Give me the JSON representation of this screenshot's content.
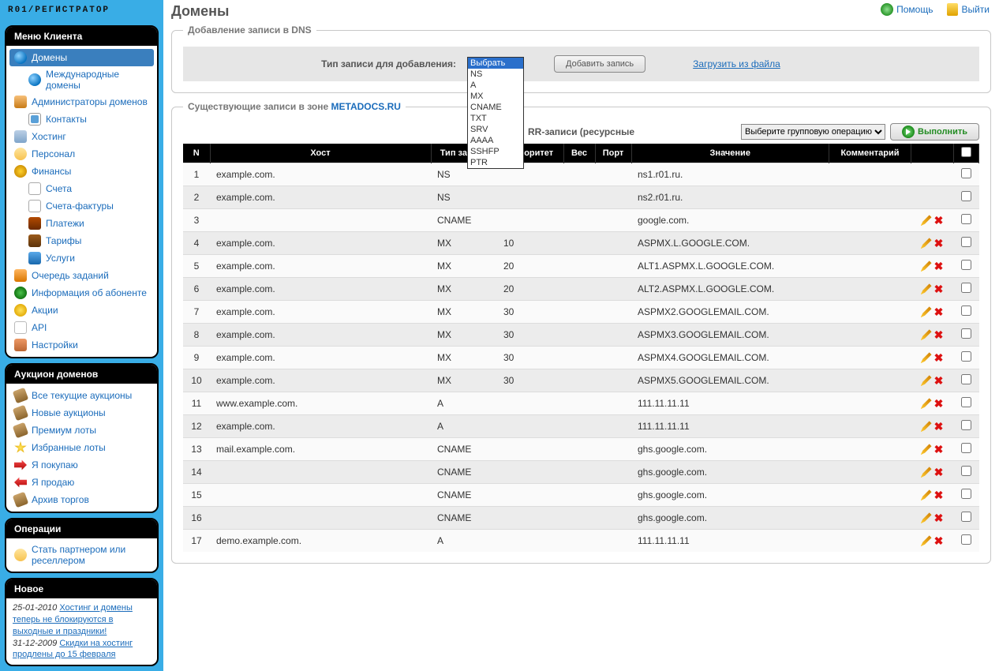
{
  "logo": "R01/РЕГИСТРАТОР",
  "head": {
    "title": "Домены",
    "help": "Помощь",
    "exit": "Выйти"
  },
  "sidebar": {
    "client_menu_hd": "Меню Клиента",
    "items": [
      {
        "label": "Домены",
        "icon": "globe",
        "sel": true
      },
      {
        "label": "Международные домены",
        "icon": "globe",
        "sub": true
      },
      {
        "label": "Администраторы доменов",
        "icon": "users"
      },
      {
        "label": "Контакты",
        "icon": "contact",
        "sub": true
      },
      {
        "label": "Хостинг",
        "icon": "host"
      },
      {
        "label": "Персонал",
        "icon": "person"
      },
      {
        "label": "Финансы",
        "icon": "money"
      },
      {
        "label": "Счета",
        "icon": "doc",
        "sub": true
      },
      {
        "label": "Счета-фактуры",
        "icon": "doc",
        "sub": true
      },
      {
        "label": "Платежи",
        "icon": "pay",
        "sub": true
      },
      {
        "label": "Тарифы",
        "icon": "tarif",
        "sub": true
      },
      {
        "label": "Услуги",
        "icon": "serv",
        "sub": true
      },
      {
        "label": "Очередь заданий",
        "icon": "queue"
      },
      {
        "label": "Информация об абоненте",
        "icon": "info"
      },
      {
        "label": "Акции",
        "icon": "star"
      },
      {
        "label": "API",
        "icon": "api"
      },
      {
        "label": "Настройки",
        "icon": "set"
      }
    ],
    "auction_hd": "Аукцион доменов",
    "auction": [
      {
        "label": "Все текущие аукционы",
        "icon": "hammer"
      },
      {
        "label": "Новые аукционы",
        "icon": "hammer"
      },
      {
        "label": "Премиум лоты",
        "icon": "hammer"
      },
      {
        "label": "Избранные лоты",
        "icon": "starS"
      },
      {
        "label": "Я покупаю",
        "icon": "arrowr"
      },
      {
        "label": "Я продаю",
        "icon": "arrowl"
      },
      {
        "label": "Архив торгов",
        "icon": "hammer"
      }
    ],
    "ops_hd": "Операции",
    "ops": [
      {
        "label": "Стать партнером или реселлером",
        "icon": "person"
      }
    ],
    "news_hd": "Новое",
    "news": [
      {
        "date": "25-01-2010",
        "text": "Хостинг и домены теперь не блокируются в выходные и праздники!"
      },
      {
        "date": "31-12-2009",
        "text": "Скидки на хостинг продлены до 15 февраля"
      }
    ]
  },
  "add": {
    "legend": "Добавление записи в DNS",
    "label": "Тип записи для добавления:",
    "select_value": "Выбрать",
    "options": [
      "Выбрать",
      "NS",
      "A",
      "MX",
      "CNAME",
      "TXT",
      "SRV",
      "AAAA",
      "SSHFP",
      "PTR"
    ],
    "btn_add": "Добавить запись",
    "upload_link": "Загрузить из файла"
  },
  "zone": {
    "legend_prefix": "Существующие записи в зоне",
    "zone_name": "METADOCS.RU",
    "rr_title": "RR-записи (ресурсные",
    "group_op_placeholder": "Выберите групповую операцию",
    "run_btn": "Выполнить",
    "cols": {
      "n": "N",
      "host": "Хост",
      "type": "Тип записи",
      "pri": "Приоритет",
      "wt": "Вес",
      "port": "Порт",
      "val": "Значение",
      "comm": "Комментарий"
    },
    "rows": [
      {
        "n": 1,
        "host": "example.com.",
        "type": "NS",
        "pri": "",
        "val": "ns1.r01.ru.",
        "editable": false
      },
      {
        "n": 2,
        "host": "example.com.",
        "type": "NS",
        "pri": "",
        "val": "ns2.r01.ru.",
        "editable": false
      },
      {
        "n": 3,
        "host": "",
        "type": "CNAME",
        "pri": "",
        "val": "google.com.",
        "editable": true
      },
      {
        "n": 4,
        "host": "example.com.",
        "type": "MX",
        "pri": "10",
        "val": "ASPMX.L.GOOGLE.COM.",
        "editable": true
      },
      {
        "n": 5,
        "host": "example.com.",
        "type": "MX",
        "pri": "20",
        "val": "ALT1.ASPMX.L.GOOGLE.COM.",
        "editable": true
      },
      {
        "n": 6,
        "host": "example.com.",
        "type": "MX",
        "pri": "20",
        "val": "ALT2.ASPMX.L.GOOGLE.COM.",
        "editable": true
      },
      {
        "n": 7,
        "host": "example.com.",
        "type": "MX",
        "pri": "30",
        "val": "ASPMX2.GOOGLEMAIL.COM.",
        "editable": true
      },
      {
        "n": 8,
        "host": "example.com.",
        "type": "MX",
        "pri": "30",
        "val": "ASPMX3.GOOGLEMAIL.COM.",
        "editable": true
      },
      {
        "n": 9,
        "host": "example.com.",
        "type": "MX",
        "pri": "30",
        "val": "ASPMX4.GOOGLEMAIL.COM.",
        "editable": true
      },
      {
        "n": 10,
        "host": "example.com.",
        "type": "MX",
        "pri": "30",
        "val": "ASPMX5.GOOGLEMAIL.COM.",
        "editable": true
      },
      {
        "n": 11,
        "host": "www.example.com.",
        "type": "A",
        "pri": "",
        "val": "111.11.11.11",
        "editable": true
      },
      {
        "n": 12,
        "host": "example.com.",
        "type": "A",
        "pri": "",
        "val": "111.11.11.11",
        "editable": true
      },
      {
        "n": 13,
        "host": "mail.example.com.",
        "type": "CNAME",
        "pri": "",
        "val": "ghs.google.com.",
        "editable": true
      },
      {
        "n": 14,
        "host": "",
        "type": "CNAME",
        "pri": "",
        "val": "ghs.google.com.",
        "editable": true
      },
      {
        "n": 15,
        "host": "",
        "type": "CNAME",
        "pri": "",
        "val": "ghs.google.com.",
        "editable": true
      },
      {
        "n": 16,
        "host": "",
        "type": "CNAME",
        "pri": "",
        "val": "ghs.google.com.",
        "editable": true
      },
      {
        "n": 17,
        "host": "demo.example.com.",
        "type": "A",
        "pri": "",
        "val": "111.11.11.11",
        "editable": true
      }
    ]
  }
}
